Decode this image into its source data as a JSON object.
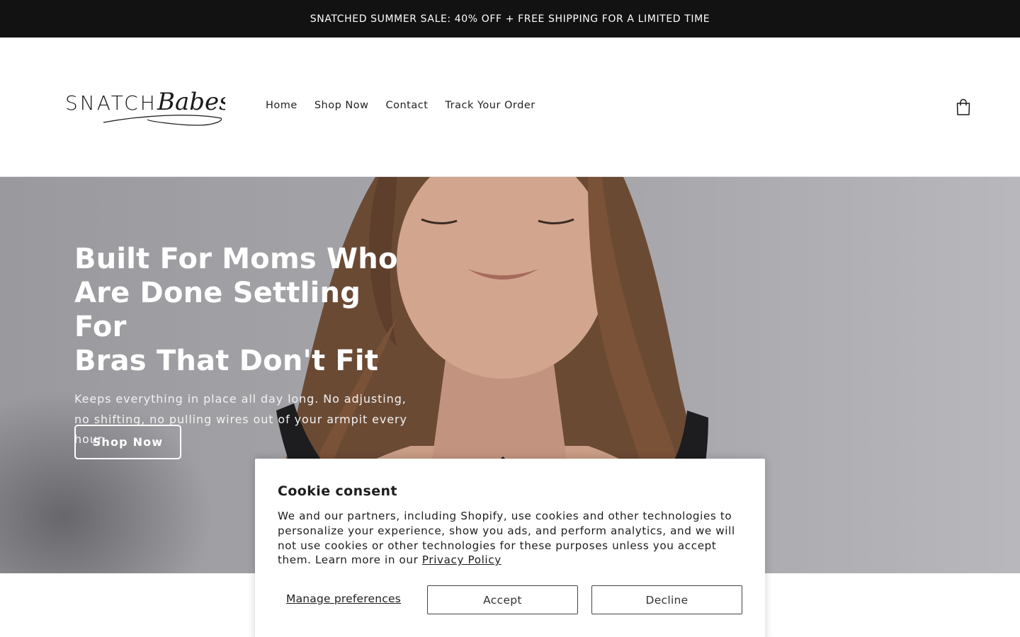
{
  "announcement": {
    "text": "SNATCHED SUMMER SALE: 40% OFF + FREE SHIPPING FOR A LIMITED TIME"
  },
  "header": {
    "logo": {
      "part1": "SNATCH",
      "part2": "Babes"
    },
    "nav": [
      {
        "label": "Home"
      },
      {
        "label": "Shop Now"
      },
      {
        "label": "Contact"
      },
      {
        "label": "Track Your Order"
      }
    ],
    "cart_icon": "shopping-bag-icon"
  },
  "hero": {
    "title_line1": "Built For Moms Who",
    "title_line2": "Are Done Settling For",
    "title_line3": "Bras That Don't Fit",
    "subtitle": "Keeps everything in place all day long. No adjusting, no shifting, no pulling wires out of your armpit every hour.",
    "button_label": "Shop Now"
  },
  "cookie_banner": {
    "title": "Cookie consent",
    "body": "We and our partners, including Shopify, use cookies and other technologies to personalize your experience, show you ads, and perform analytics, and we will not use cookies or other technologies for these purposes unless you accept them. Learn more in our ",
    "privacy_link": "Privacy Policy",
    "manage_label": "Manage preferences",
    "accept_label": "Accept",
    "decline_label": "Decline"
  },
  "colors": {
    "announcement_bg": "#121212",
    "hero_bg": "#a2a2a6",
    "text": "#121212",
    "white": "#ffffff"
  }
}
